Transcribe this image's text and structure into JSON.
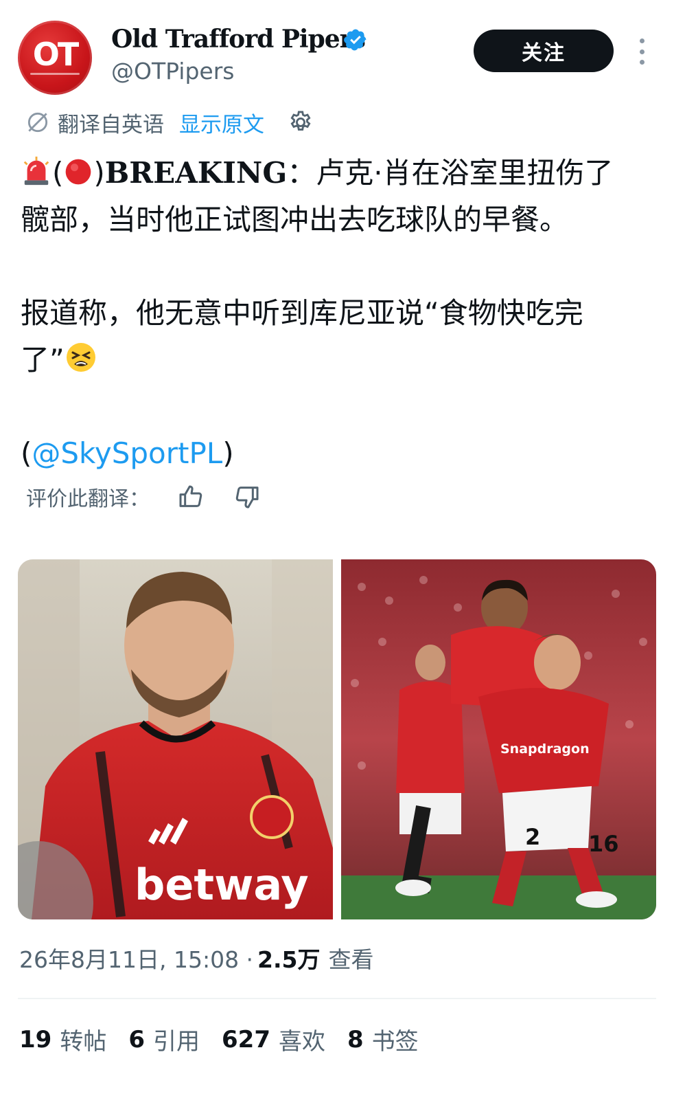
{
  "header": {
    "avatar_text": "OT",
    "account_name": "Old Trafford Pipers",
    "handle": "@OTPipers",
    "follow_label": "关注"
  },
  "translation": {
    "translated_from": "翻译自英语",
    "show_original": "显示原文"
  },
  "tweet": {
    "breaking_prefix": "(",
    "breaking_suffix": ")",
    "breaking_word": "BREAKING",
    "line1_rest": "：卢克·肖在浴室里扭伤了",
    "line2": "髋部，当时他正试图冲出去吃球队的早餐。",
    "para2_line1": "报道称，他无意中听到库尼亚说“食物快吃完",
    "para2_line2": "了”",
    "mention_open": "(",
    "mention": "@SkySportPL",
    "mention_close": ")"
  },
  "rate": {
    "label": "评价此翻译："
  },
  "media": {
    "left_jersey_text": "betway",
    "right_jersey_text": "Snapdragon",
    "right_number_a": "2",
    "right_number_b": "16"
  },
  "meta": {
    "timestamp": "26年8月11日, 15:08 ·",
    "views_count": "2.5万",
    "views_label": "查看"
  },
  "stats": [
    {
      "num": "19",
      "label": "转帖"
    },
    {
      "num": "6",
      "label": "引用"
    },
    {
      "num": "627",
      "label": "喜欢"
    },
    {
      "num": "8",
      "label": "书签"
    }
  ],
  "colors": {
    "accent": "#1d9bf0",
    "text": "#0f1419",
    "muted": "#536471",
    "brand_red": "#c8151a"
  }
}
